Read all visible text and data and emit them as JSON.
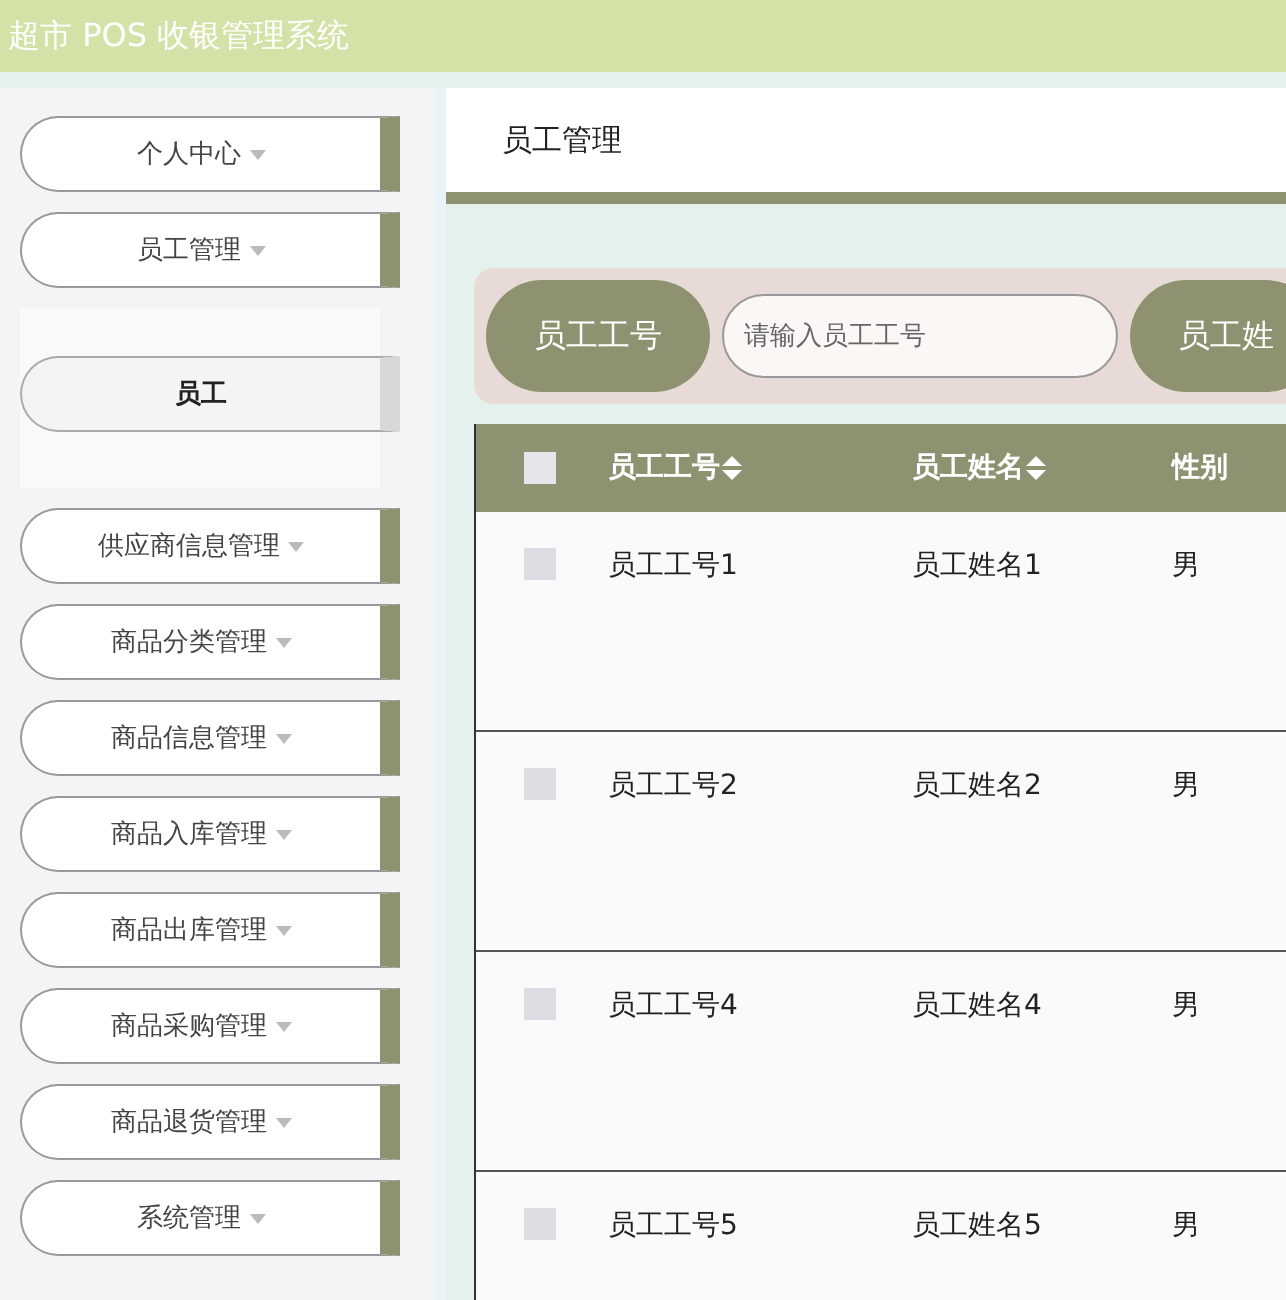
{
  "header": {
    "title": "超市 POS 收银管理系统"
  },
  "sidebar": {
    "items": [
      {
        "label": "个人中心"
      },
      {
        "label": "员工管理",
        "children": [
          {
            "label": "员工",
            "selected": true
          }
        ]
      },
      {
        "label": "供应商信息管理"
      },
      {
        "label": "商品分类管理"
      },
      {
        "label": "商品信息管理"
      },
      {
        "label": "商品入库管理"
      },
      {
        "label": "商品出库管理"
      },
      {
        "label": "商品采购管理"
      },
      {
        "label": "商品退货管理"
      },
      {
        "label": "系统管理"
      }
    ]
  },
  "breadcrumb": "员工管理",
  "search": {
    "fields": [
      {
        "label": "员工工号",
        "placeholder": "请输入员工工号"
      },
      {
        "label": "员工姓"
      }
    ]
  },
  "table": {
    "select_all": {
      "checked": false
    },
    "columns": [
      {
        "label": "员工工号",
        "sortable": true
      },
      {
        "label": "员工姓名",
        "sortable": true
      },
      {
        "label": "性别"
      }
    ],
    "rows": [
      {
        "checked": false,
        "cells": [
          "员工工号1",
          "员工姓名1",
          "男"
        ]
      },
      {
        "checked": false,
        "cells": [
          "员工工号2",
          "员工姓名2",
          "男"
        ]
      },
      {
        "checked": false,
        "cells": [
          "员工工号4",
          "员工姓名4",
          "男"
        ]
      },
      {
        "checked": false,
        "cells": [
          "员工工号5",
          "员工姓名5",
          "男"
        ]
      }
    ]
  }
}
